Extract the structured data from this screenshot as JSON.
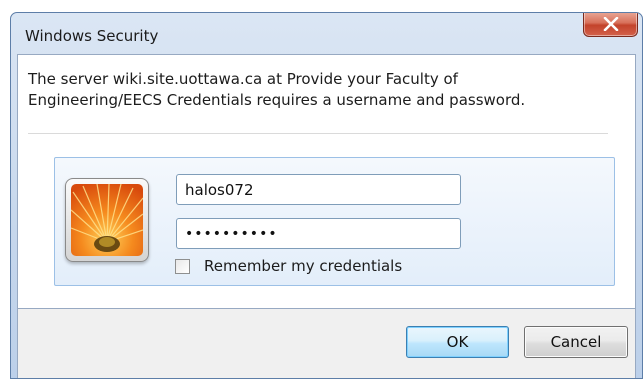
{
  "window": {
    "title": "Windows Security",
    "close_symbol": "X"
  },
  "message": {
    "text": "The server wiki.site.uottawa.ca at Provide your Faculty of Engineering/EECS Credentials requires a username and password."
  },
  "credentials": {
    "avatar_icon": "flower-user-tile-icon",
    "username_value": "halos072",
    "password_value": "••••••••••",
    "remember_label": "Remember my credentials",
    "remember_checked": false
  },
  "buttons": {
    "ok_label": "OK",
    "cancel_label": "Cancel"
  },
  "colors": {
    "close_button": "#c3432b",
    "ok_border": "#3c7fb1",
    "tile_border": "#9cc0e6"
  }
}
